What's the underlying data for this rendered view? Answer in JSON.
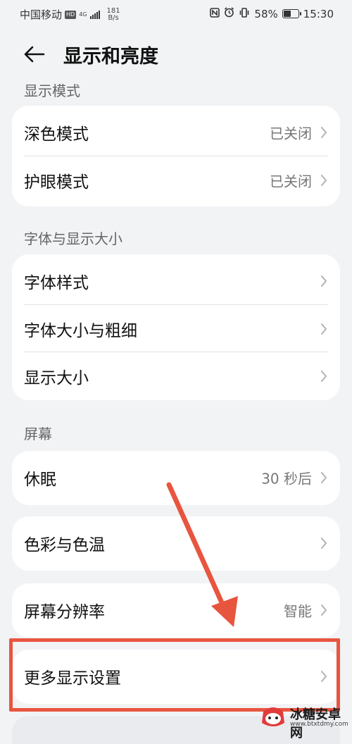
{
  "status_bar": {
    "carrier": "中国移动",
    "hd_badge": "HD",
    "network": "4G",
    "speed_value": "181",
    "speed_unit": "B/s",
    "nfc_icon": "nfc-icon",
    "alarm_icon": "alarm-icon",
    "vibrate_icon": "vibrate-icon",
    "battery_percent": "58%",
    "battery_level": 0.58,
    "time": "15:30"
  },
  "header": {
    "title": "显示和亮度",
    "back_icon": "back-arrow-icon"
  },
  "sections": [
    {
      "label": "显示模式",
      "items": [
        {
          "label": "深色模式",
          "value": "已关闭"
        },
        {
          "label": "护眼模式",
          "value": "已关闭"
        }
      ]
    },
    {
      "label": "字体与显示大小",
      "items": [
        {
          "label": "字体样式",
          "value": ""
        },
        {
          "label": "字体大小与粗细",
          "value": ""
        },
        {
          "label": "显示大小",
          "value": ""
        }
      ]
    },
    {
      "label": "屏幕",
      "items": [
        {
          "label": "休眠",
          "value": "30 秒后"
        }
      ]
    }
  ],
  "standalone": [
    {
      "label": "色彩与色温",
      "value": ""
    },
    {
      "label": "屏幕分辨率",
      "value": "智能"
    },
    {
      "label": "更多显示设置",
      "value": ""
    }
  ],
  "watermark": {
    "name": "冰糖安卓网",
    "url": "www.btxtdmy.com"
  },
  "colors": {
    "background": "#f1f3f5",
    "card": "#ffffff",
    "annotation": "#e8553f"
  }
}
